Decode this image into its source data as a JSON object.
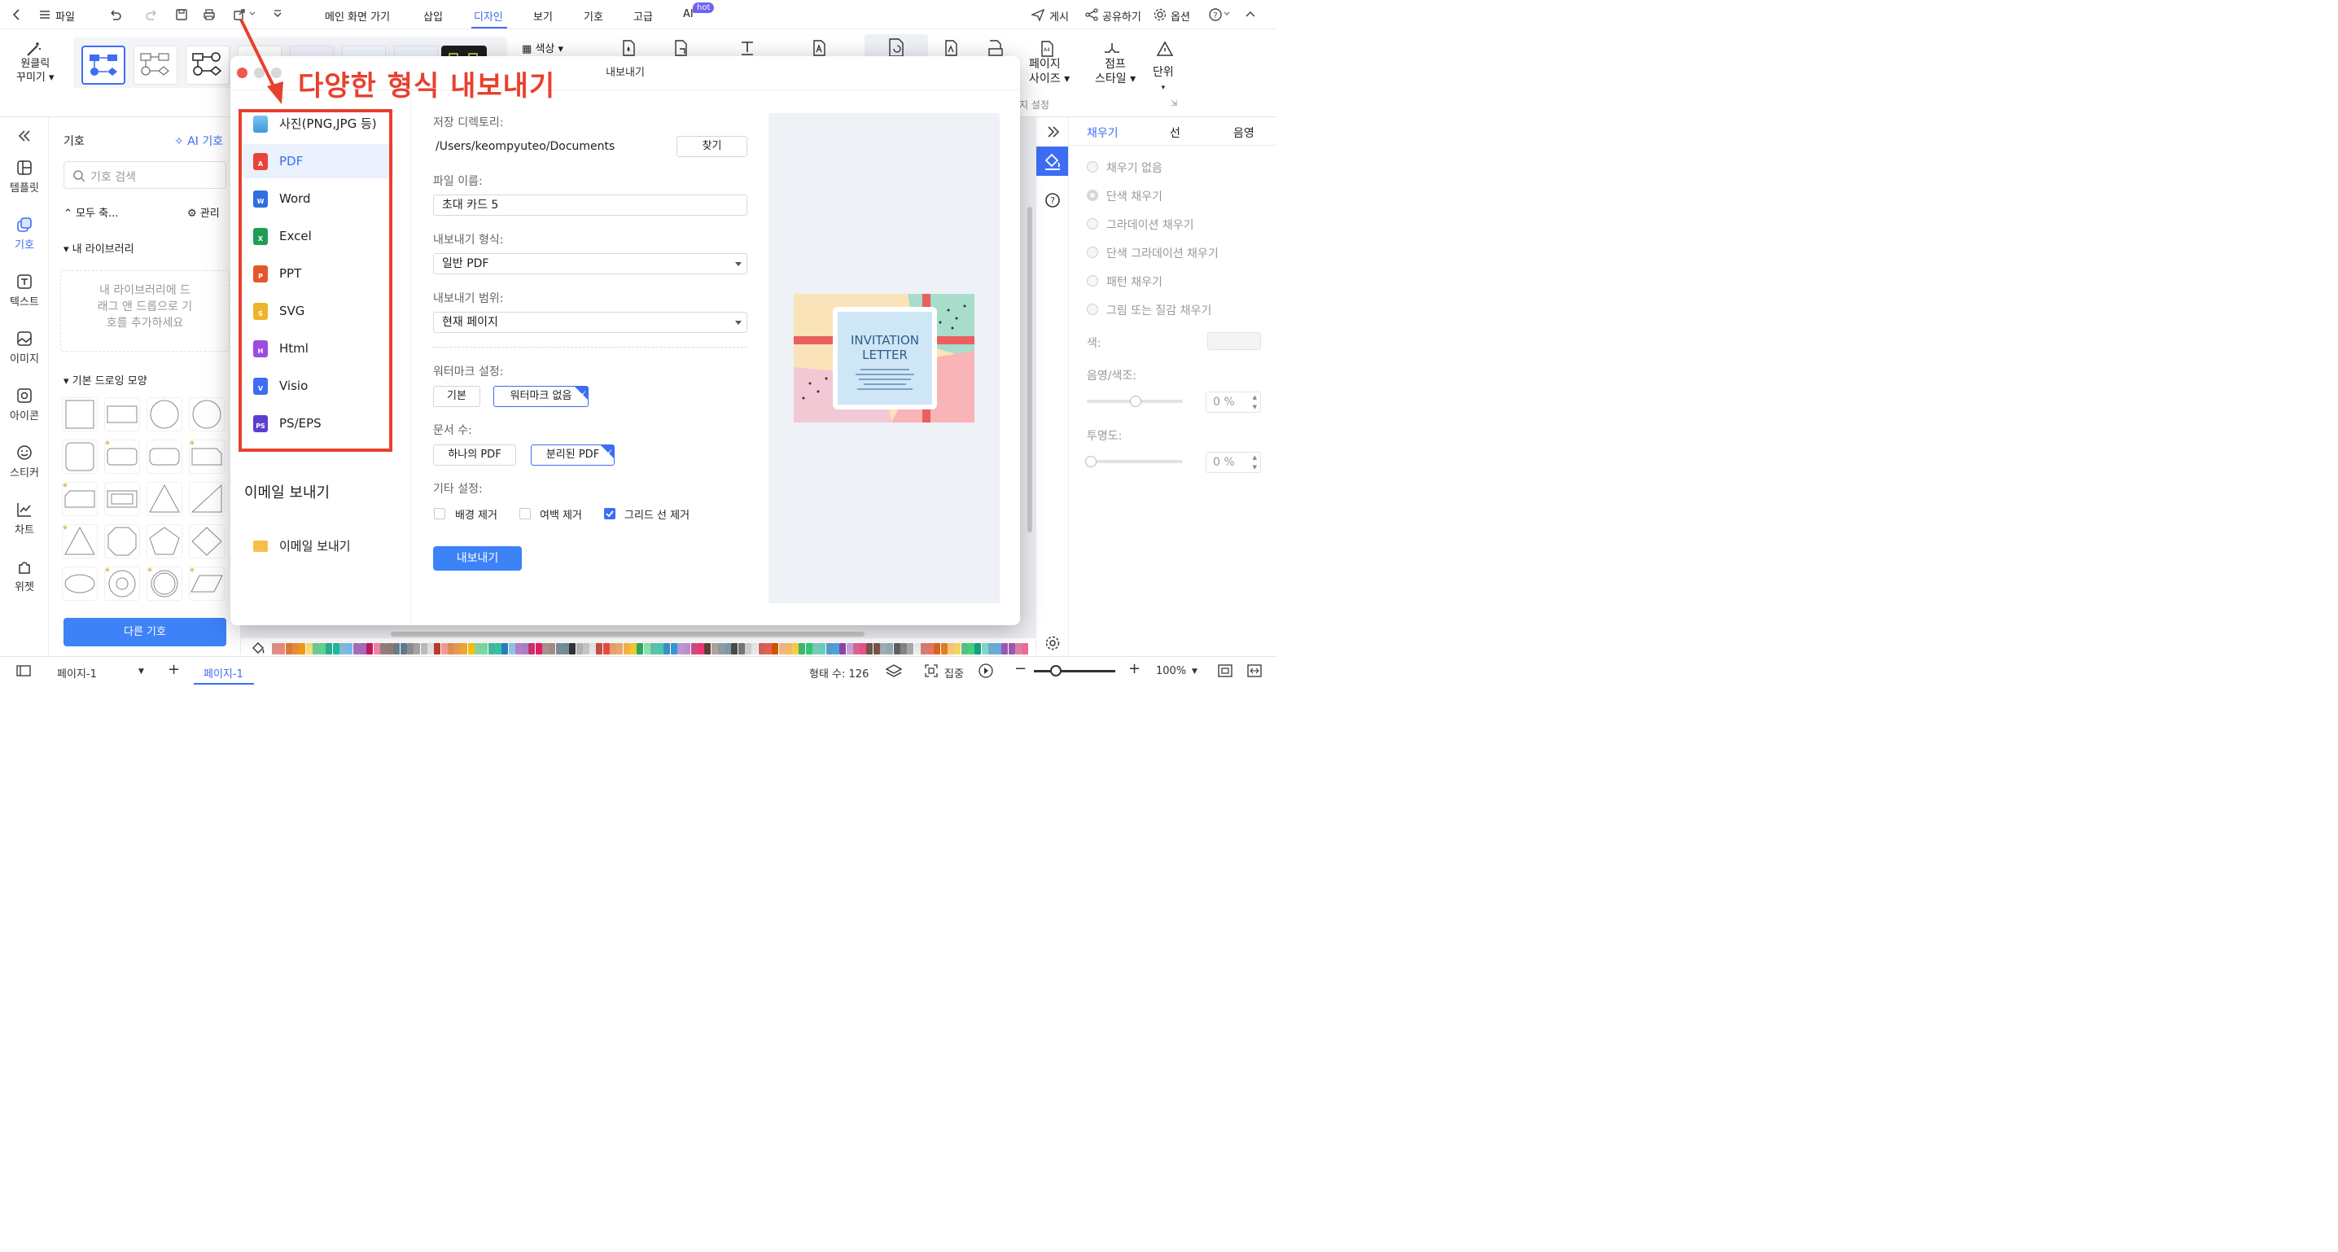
{
  "menubar": {
    "file": "파일",
    "tabs": [
      "메인 화면 가기",
      "삽입",
      "디자인",
      "보기",
      "기호",
      "고급",
      "AI"
    ],
    "hot_badge": "hot",
    "publish": "게시",
    "share": "공유하기",
    "options": "옵션"
  },
  "ribbon": {
    "one_click": "원클릭",
    "decorate": "꾸미기",
    "color": "색상",
    "page_size_1": "페이지",
    "page_size_2": "사이즈",
    "jump_style_1": "점프",
    "jump_style_2": "스타일",
    "unit": "단위",
    "page_settings": "지 설정"
  },
  "leftnav": {
    "items": [
      "템플릿",
      "기호",
      "텍스트",
      "이미지",
      "아이콘",
      "스티커",
      "차트",
      "위젯"
    ]
  },
  "symbols": {
    "title": "기호",
    "ai_symbols": "AI 기호",
    "search_placeholder": "기호 검색",
    "collapse_all": "모두 축...",
    "manage": "관리",
    "my_library": "내 라이브러리",
    "library_hint": "내 라이브러리에 드래그 앤 드롭으로 기호를 추가하세요",
    "basic_shapes": "기본 드로잉 모양",
    "more_symbols": "다른 기호"
  },
  "rightpanel": {
    "tabs": [
      "채우기",
      "선",
      "음영"
    ],
    "fill_options": [
      "채우기 없음",
      "단색 채우기",
      "그라데이션 채우기",
      "단색 그라데이션 채우기",
      "패턴 채우기",
      "그림 또는 질감 채우기"
    ],
    "color_label": "색:",
    "shade_label": "음영/색조:",
    "shade_value": "0 %",
    "transparency_label": "투명도:",
    "transparency_value": "0 %"
  },
  "statusbar": {
    "page_selector": "페이지-1",
    "page_tab": "페이지-1",
    "shape_count": "형태 수: 126",
    "focus": "집중",
    "zoom": "100%"
  },
  "dialog": {
    "title": "내보내기",
    "formats": [
      "사진(PNG,JPG 등)",
      "PDF",
      "Word",
      "Excel",
      "PPT",
      "SVG",
      "Html",
      "Visio",
      "PS/EPS"
    ],
    "selected_format": "PDF",
    "email_section": "이메일 보내기",
    "email_item": "이메일 보내기",
    "save_dir_label": "저장 디렉토리:",
    "save_dir_value": "/Users/keompyuteo/Documents",
    "browse": "찾기",
    "filename_label": "파일 이름:",
    "filename_value": "초대 카드 5",
    "export_format_label": "내보내기 형식:",
    "export_format_value": "일반 PDF",
    "export_range_label": "내보내기 범위:",
    "export_range_value": "현재 페이지",
    "watermark_label": "워터마크 설정:",
    "watermark_basic": "기본",
    "watermark_none": "워터마크 없음",
    "doc_count_label": "문서 수:",
    "single_pdf": "하나의 PDF",
    "separate_pdf": "분리된 PDF",
    "other_label": "기타 설정:",
    "remove_bg": "배경 제거",
    "remove_margin": "여백 제거",
    "remove_grid": "그리드 선 제거",
    "remove_grid_checked": true,
    "export_button": "내보내기"
  },
  "preview_card": {
    "heading_1": "INVITATION",
    "heading_2": "LETTER"
  },
  "annotation": {
    "text": "다양한 형식 내보내기",
    "color": "#e8402f"
  },
  "colors": {
    "accent": "#3d6df2",
    "annotation_red": "#e8402f"
  }
}
